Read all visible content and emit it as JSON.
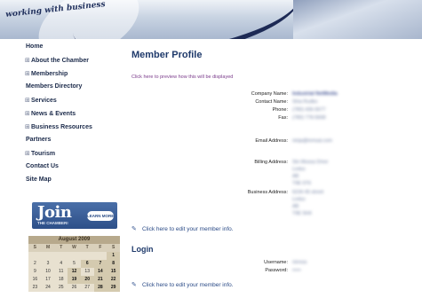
{
  "header": {
    "tagline": "working with business"
  },
  "sidebar": {
    "items": [
      {
        "label": "Home",
        "expandable": false
      },
      {
        "label": "About the Chamber",
        "expandable": true
      },
      {
        "label": "Membership",
        "expandable": true
      },
      {
        "label": "Members Directory",
        "expandable": false
      },
      {
        "label": "Services",
        "expandable": true
      },
      {
        "label": "News & Events",
        "expandable": true
      },
      {
        "label": "Business Resources",
        "expandable": true
      },
      {
        "label": "Partners",
        "expandable": false
      },
      {
        "label": "Tourism",
        "expandable": true
      },
      {
        "label": "Contact Us",
        "expandable": false
      },
      {
        "label": "Site Map",
        "expandable": false
      }
    ],
    "expand_glyph": "⊞",
    "join": {
      "main": "Join",
      "sub": "THE CHAMBER!",
      "button": "LEARN MORE"
    },
    "calendar": {
      "title": "August 2009",
      "day_headers": [
        "S",
        "M",
        "T",
        "W",
        "T",
        "F",
        "S"
      ],
      "weeks": [
        [
          "",
          "",
          "",
          "",
          "",
          "",
          "1"
        ],
        [
          "2",
          "3",
          "4",
          "5",
          "6",
          "7",
          "8"
        ],
        [
          "9",
          "10",
          "11",
          "12",
          "13",
          "14",
          "15"
        ],
        [
          "16",
          "17",
          "18",
          "19",
          "20",
          "21",
          "22"
        ],
        [
          "23",
          "24",
          "25",
          "26",
          "27",
          "28",
          "29"
        ]
      ]
    }
  },
  "main": {
    "title": "Member Profile",
    "preview_link": "Click here to preview how this will be displayed",
    "fields": [
      {
        "label": "Company Name:",
        "value": "Industrial NetMedia",
        "strong": true
      },
      {
        "label": "Contact Name:",
        "value": "Shia Rudko",
        "strong": false
      },
      {
        "label": "Phone:",
        "value": "(780) 436-5677",
        "strong": false
      },
      {
        "label": "Fax:",
        "value": "(780) 778-5668",
        "strong": false
      },
      {
        "label": "Email Address:",
        "value": "ninja@inmsai.com",
        "strong": false
      },
      {
        "label": "Billing Address:",
        "value": "Stn Mossa Drive",
        "strong": false
      },
      {
        "label": "Business Address:",
        "value": "6234 45 street",
        "strong": false
      }
    ],
    "billing_extra": [
      "Leduc",
      "AB",
      "T9E 6T6"
    ],
    "business_extra": [
      "Leduc",
      "AB",
      "T9E 5H4"
    ],
    "edit_link": "Click here to edit your member info.",
    "login": {
      "title": "Login",
      "username_label": "Username:",
      "username_value": "ninnsa",
      "password_label": "Password:",
      "password_value": "•••••"
    }
  }
}
